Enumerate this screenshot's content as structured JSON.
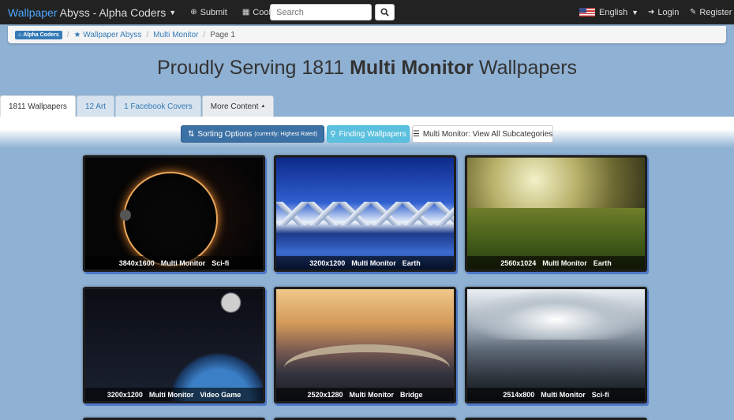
{
  "navbar": {
    "brand_highlight": "Wallpaper",
    "brand_rest": " Abyss - Alpha Coders",
    "submit": "Submit",
    "cool_stuff": "Cool Stuff",
    "search_placeholder": "Search",
    "language": "English",
    "login": "Login",
    "register": "Register"
  },
  "breadcrumb": {
    "badge": "Alpha Coders",
    "items": [
      "Wallpaper Abyss",
      "Multi Monitor"
    ],
    "current": "Page 1"
  },
  "heading": {
    "prefix": "Proudly Serving 1811 ",
    "bold": "Multi Monitor",
    "suffix": " Wallpapers"
  },
  "tabs": [
    {
      "label": "1811 Wallpapers",
      "active": true
    },
    {
      "label": "12 Art"
    },
    {
      "label": "1 Facebook Covers"
    },
    {
      "label": "More Content"
    }
  ],
  "options": {
    "sort_label": "Sorting Options",
    "sort_current": "(currently: Highest Rated)",
    "finding": "Finding Wallpapers",
    "subcategories": "Multi Monitor: View All Subcategories"
  },
  "wallpapers": [
    {
      "resolution": "3840x1600",
      "category": "Multi Monitor",
      "subcategory": "Sci-fi"
    },
    {
      "resolution": "3200x1200",
      "category": "Multi Monitor",
      "subcategory": "Earth"
    },
    {
      "resolution": "2560x1024",
      "category": "Multi Monitor",
      "subcategory": "Earth"
    },
    {
      "resolution": "3200x1200",
      "category": "Multi Monitor",
      "subcategory": "Video Game"
    },
    {
      "resolution": "2520x1280",
      "category": "Multi Monitor",
      "subcategory": "Bridge"
    },
    {
      "resolution": "2514x800",
      "category": "Multi Monitor",
      "subcategory": "Sci-fi"
    }
  ],
  "colors": {
    "navbar": "#222222",
    "brand_accent": "#4da6ff",
    "primary_button": "#3c71a5",
    "info_button": "#5bc0de",
    "page_bg": "#8fb1d3"
  }
}
